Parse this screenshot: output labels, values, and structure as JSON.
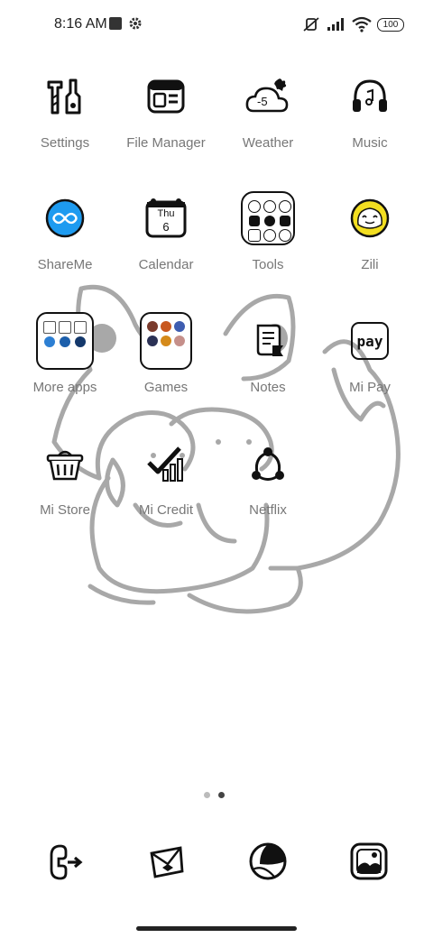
{
  "status_bar": {
    "time": "8:16 AM",
    "battery": "100"
  },
  "apps": {
    "settings": "Settings",
    "file_manager": "File Manager",
    "weather": "Weather",
    "weather_temp": "-5",
    "music": "Music",
    "shareme": "ShareMe",
    "calendar": "Calendar",
    "calendar_day": "Thu",
    "calendar_date": "6",
    "tools": "Tools",
    "zili": "Zili",
    "more_apps": "More apps",
    "games": "Games",
    "notes": "Notes",
    "mi_pay": "Mi Pay",
    "mi_pay_icon_text": "pay",
    "mi_store": "Mi Store",
    "mi_credit": "Mi Credit",
    "netflix": "Netflix"
  },
  "colors": {
    "shareme_blue": "#1e9bf0",
    "zili_yellow": "#f2de21",
    "label_gray": "#777777"
  }
}
